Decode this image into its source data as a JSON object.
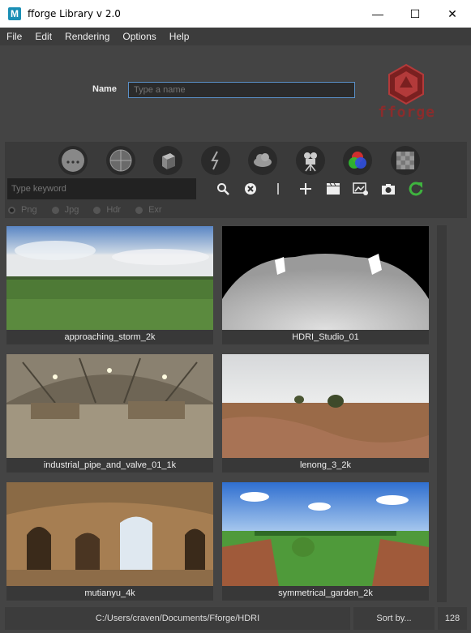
{
  "window": {
    "title": "fforge Library v 2.0",
    "app_icon": "M",
    "minimize": "—",
    "maximize": "☐",
    "close": "✕"
  },
  "menu": [
    "File",
    "Edit",
    "Rendering",
    "Options",
    "Help"
  ],
  "header": {
    "name_label": "Name",
    "name_placeholder": "Type a name",
    "logo_text": "fforge"
  },
  "categories": [
    {
      "icon": "more-dots-icon"
    },
    {
      "icon": "sphere-material-icon"
    },
    {
      "icon": "cube-icon"
    },
    {
      "icon": "lightning-icon"
    },
    {
      "icon": "cloud-icon"
    },
    {
      "icon": "camera-icon"
    },
    {
      "icon": "rgb-color-icon"
    },
    {
      "icon": "checker-texture-icon"
    }
  ],
  "search": {
    "placeholder": "Type keyword"
  },
  "tools": [
    {
      "icon": "search-icon",
      "glyph": "🔍"
    },
    {
      "icon": "clear-icon",
      "glyph": "⊗"
    },
    {
      "icon": "separator-icon",
      "glyph": "⁞"
    },
    {
      "icon": "add-icon",
      "glyph": "+"
    },
    {
      "icon": "clapperboard-icon",
      "glyph": "🎬"
    },
    {
      "icon": "image-import-icon",
      "glyph": "🖼"
    },
    {
      "icon": "screenshot-camera-icon",
      "glyph": "📷"
    },
    {
      "icon": "refresh-icon",
      "glyph": "↻"
    }
  ],
  "formats": [
    {
      "label": "Png",
      "selected": true
    },
    {
      "label": "Jpg",
      "selected": false
    },
    {
      "label": "Hdr",
      "selected": false
    },
    {
      "label": "Exr",
      "selected": false
    }
  ],
  "items": [
    {
      "label": "approaching_storm_2k"
    },
    {
      "label": "HDRI_Studio_01"
    },
    {
      "label": "industrial_pipe_and_valve_01_1k"
    },
    {
      "label": "lenong_3_2k"
    },
    {
      "label": "mutianyu_4k"
    },
    {
      "label": "symmetrical_garden_2k"
    }
  ],
  "status": {
    "path": "C:/Users/craven/Documents/Fforge/HDRI",
    "sort_label": "Sort by...",
    "thumb_size": "128"
  },
  "colors": {
    "accent_blue": "#5a90c8",
    "refresh_green": "#3fb33f",
    "logo_red": "#b33a3a"
  }
}
